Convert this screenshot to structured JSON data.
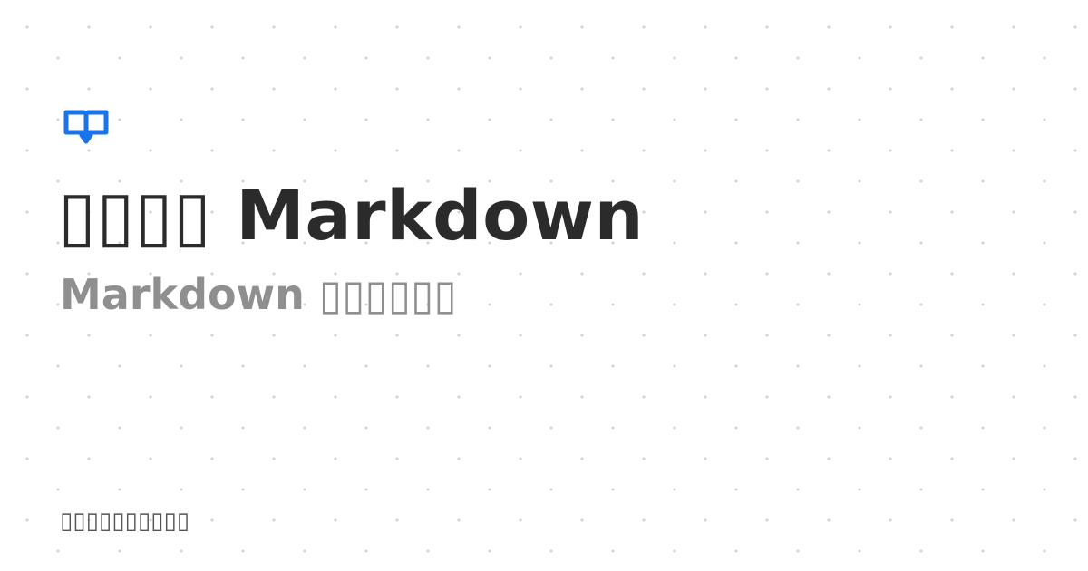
{
  "logo": {
    "icon": "book-open-icon",
    "color": "#1a73e8"
  },
  "title": "▯▯▯▯ Markdown",
  "subtitle": "Markdown ▯▯▯▯▯▯",
  "footer": "▯▯▯▯▯▯▯▯▯▯"
}
